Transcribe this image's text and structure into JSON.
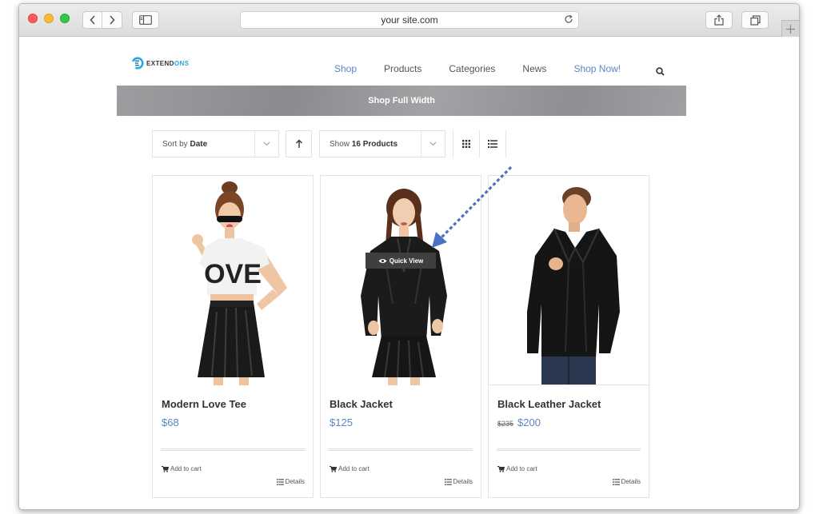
{
  "browser": {
    "url": "your site.com"
  },
  "site": {
    "logo_text_dark": "EXTEND",
    "logo_text_blue": "ONS",
    "menu": [
      {
        "label": "Shop"
      },
      {
        "label": "Products"
      },
      {
        "label": "Categories"
      },
      {
        "label": "News"
      },
      {
        "label": "Shop Now!"
      }
    ],
    "banner_title": "Shop Full Width"
  },
  "toolbar": {
    "sort_prefix": "Sort by",
    "sort_value": "Date",
    "show_prefix": "Show",
    "show_value": "16 Products"
  },
  "products": [
    {
      "title": "Modern Love Tee",
      "price": "$68",
      "add_to_cart": "Add to cart",
      "details": "Details"
    },
    {
      "title": "Black Jacket",
      "price": "$125",
      "add_to_cart": "Add to cart",
      "details": "Details",
      "quick_view": "Quick View"
    },
    {
      "title": "Black Leather Jacket",
      "old_price": "$235",
      "price": "$200",
      "add_to_cart": "Add to cart",
      "details": "Details"
    }
  ],
  "colors": {
    "accent_blue": "#5a86c4",
    "logo_blue": "#28a7e0",
    "banner_gray": "#95969a",
    "arrow_blue": "#4a72c4"
  }
}
